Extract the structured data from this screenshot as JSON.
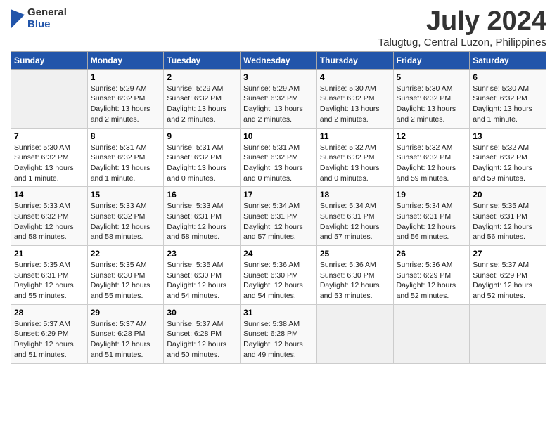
{
  "logo": {
    "general": "General",
    "blue": "Blue"
  },
  "title": "July 2024",
  "subtitle": "Talugtug, Central Luzon, Philippines",
  "days_header": [
    "Sunday",
    "Monday",
    "Tuesday",
    "Wednesday",
    "Thursday",
    "Friday",
    "Saturday"
  ],
  "weeks": [
    [
      {
        "num": "",
        "info": ""
      },
      {
        "num": "1",
        "info": "Sunrise: 5:29 AM\nSunset: 6:32 PM\nDaylight: 13 hours\nand 2 minutes."
      },
      {
        "num": "2",
        "info": "Sunrise: 5:29 AM\nSunset: 6:32 PM\nDaylight: 13 hours\nand 2 minutes."
      },
      {
        "num": "3",
        "info": "Sunrise: 5:29 AM\nSunset: 6:32 PM\nDaylight: 13 hours\nand 2 minutes."
      },
      {
        "num": "4",
        "info": "Sunrise: 5:30 AM\nSunset: 6:32 PM\nDaylight: 13 hours\nand 2 minutes."
      },
      {
        "num": "5",
        "info": "Sunrise: 5:30 AM\nSunset: 6:32 PM\nDaylight: 13 hours\nand 2 minutes."
      },
      {
        "num": "6",
        "info": "Sunrise: 5:30 AM\nSunset: 6:32 PM\nDaylight: 13 hours\nand 1 minute."
      }
    ],
    [
      {
        "num": "7",
        "info": "Sunrise: 5:30 AM\nSunset: 6:32 PM\nDaylight: 13 hours\nand 1 minute."
      },
      {
        "num": "8",
        "info": "Sunrise: 5:31 AM\nSunset: 6:32 PM\nDaylight: 13 hours\nand 1 minute."
      },
      {
        "num": "9",
        "info": "Sunrise: 5:31 AM\nSunset: 6:32 PM\nDaylight: 13 hours\nand 0 minutes."
      },
      {
        "num": "10",
        "info": "Sunrise: 5:31 AM\nSunset: 6:32 PM\nDaylight: 13 hours\nand 0 minutes."
      },
      {
        "num": "11",
        "info": "Sunrise: 5:32 AM\nSunset: 6:32 PM\nDaylight: 13 hours\nand 0 minutes."
      },
      {
        "num": "12",
        "info": "Sunrise: 5:32 AM\nSunset: 6:32 PM\nDaylight: 12 hours\nand 59 minutes."
      },
      {
        "num": "13",
        "info": "Sunrise: 5:32 AM\nSunset: 6:32 PM\nDaylight: 12 hours\nand 59 minutes."
      }
    ],
    [
      {
        "num": "14",
        "info": "Sunrise: 5:33 AM\nSunset: 6:32 PM\nDaylight: 12 hours\nand 58 minutes."
      },
      {
        "num": "15",
        "info": "Sunrise: 5:33 AM\nSunset: 6:32 PM\nDaylight: 12 hours\nand 58 minutes."
      },
      {
        "num": "16",
        "info": "Sunrise: 5:33 AM\nSunset: 6:31 PM\nDaylight: 12 hours\nand 58 minutes."
      },
      {
        "num": "17",
        "info": "Sunrise: 5:34 AM\nSunset: 6:31 PM\nDaylight: 12 hours\nand 57 minutes."
      },
      {
        "num": "18",
        "info": "Sunrise: 5:34 AM\nSunset: 6:31 PM\nDaylight: 12 hours\nand 57 minutes."
      },
      {
        "num": "19",
        "info": "Sunrise: 5:34 AM\nSunset: 6:31 PM\nDaylight: 12 hours\nand 56 minutes."
      },
      {
        "num": "20",
        "info": "Sunrise: 5:35 AM\nSunset: 6:31 PM\nDaylight: 12 hours\nand 56 minutes."
      }
    ],
    [
      {
        "num": "21",
        "info": "Sunrise: 5:35 AM\nSunset: 6:31 PM\nDaylight: 12 hours\nand 55 minutes."
      },
      {
        "num": "22",
        "info": "Sunrise: 5:35 AM\nSunset: 6:30 PM\nDaylight: 12 hours\nand 55 minutes."
      },
      {
        "num": "23",
        "info": "Sunrise: 5:35 AM\nSunset: 6:30 PM\nDaylight: 12 hours\nand 54 minutes."
      },
      {
        "num": "24",
        "info": "Sunrise: 5:36 AM\nSunset: 6:30 PM\nDaylight: 12 hours\nand 54 minutes."
      },
      {
        "num": "25",
        "info": "Sunrise: 5:36 AM\nSunset: 6:30 PM\nDaylight: 12 hours\nand 53 minutes."
      },
      {
        "num": "26",
        "info": "Sunrise: 5:36 AM\nSunset: 6:29 PM\nDaylight: 12 hours\nand 52 minutes."
      },
      {
        "num": "27",
        "info": "Sunrise: 5:37 AM\nSunset: 6:29 PM\nDaylight: 12 hours\nand 52 minutes."
      }
    ],
    [
      {
        "num": "28",
        "info": "Sunrise: 5:37 AM\nSunset: 6:29 PM\nDaylight: 12 hours\nand 51 minutes."
      },
      {
        "num": "29",
        "info": "Sunrise: 5:37 AM\nSunset: 6:28 PM\nDaylight: 12 hours\nand 51 minutes."
      },
      {
        "num": "30",
        "info": "Sunrise: 5:37 AM\nSunset: 6:28 PM\nDaylight: 12 hours\nand 50 minutes."
      },
      {
        "num": "31",
        "info": "Sunrise: 5:38 AM\nSunset: 6:28 PM\nDaylight: 12 hours\nand 49 minutes."
      },
      {
        "num": "",
        "info": ""
      },
      {
        "num": "",
        "info": ""
      },
      {
        "num": "",
        "info": ""
      }
    ]
  ]
}
